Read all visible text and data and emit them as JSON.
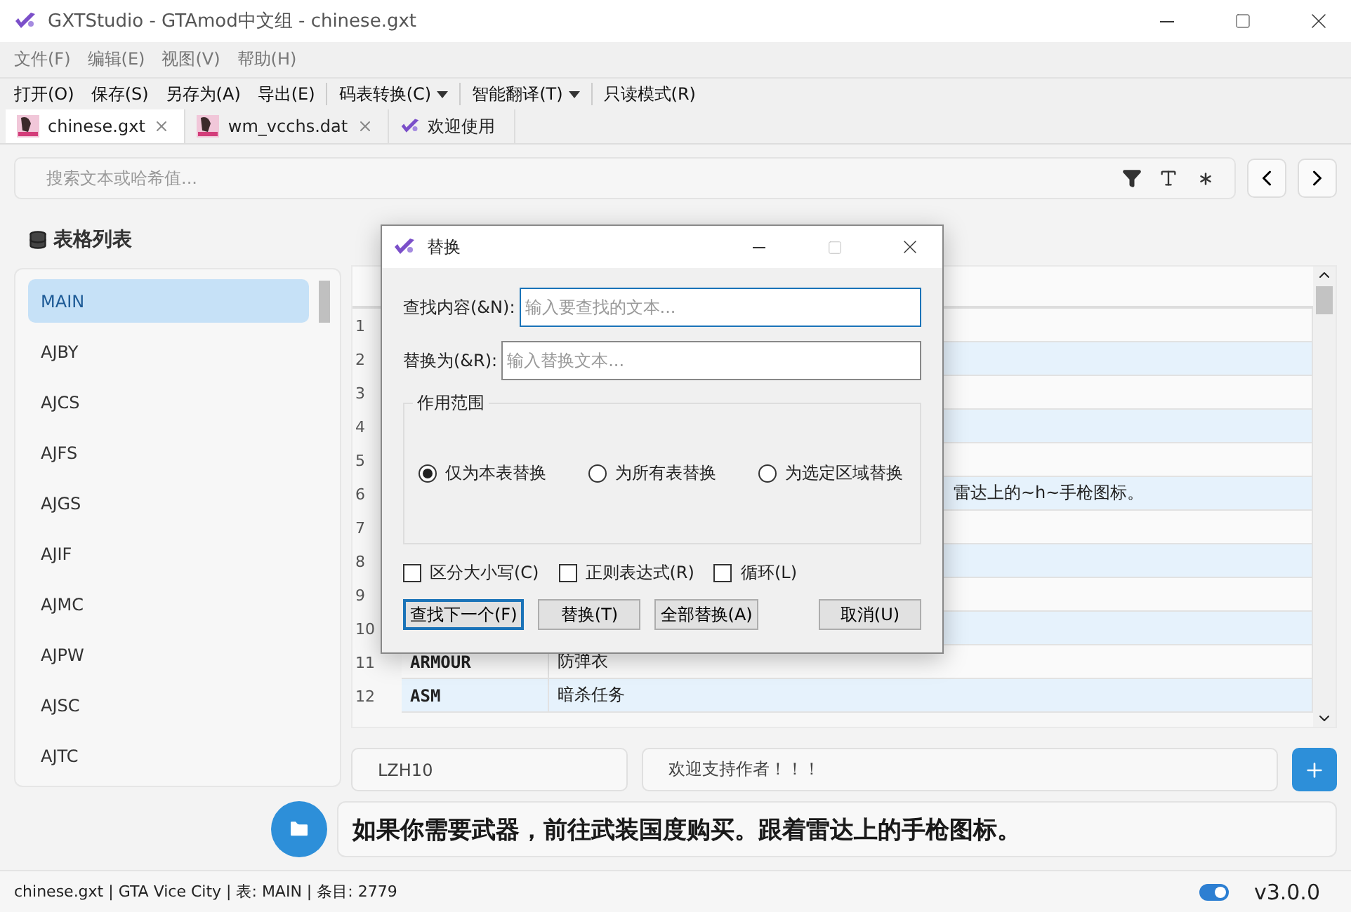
{
  "window": {
    "title": "GXTStudio - GTAmod中文组 - chinese.gxt"
  },
  "menu": [
    "文件(F)",
    "编辑(E)",
    "视图(V)",
    "帮助(H)"
  ],
  "toolbar": [
    {
      "label": "打开(O)",
      "kind": "plain"
    },
    {
      "label": "保存(S)",
      "kind": "plain"
    },
    {
      "label": "另存为(A)",
      "kind": "plain"
    },
    {
      "label": "导出(E)",
      "kind": "plain"
    },
    {
      "label": "码表转换(C)",
      "kind": "dropdown"
    },
    {
      "label": "智能翻译(T)",
      "kind": "dropdown"
    },
    {
      "label": "只读模式(R)",
      "kind": "plain"
    }
  ],
  "tabs": [
    {
      "label": "chinese.gxt",
      "kind": "file",
      "selected": true
    },
    {
      "label": "wm_vcchs.dat",
      "kind": "file",
      "selected": false
    },
    {
      "label": "欢迎使用",
      "kind": "welcome",
      "selected": false
    }
  ],
  "search": {
    "placeholder": "搜索文本或哈希值..."
  },
  "sidebar": {
    "title": "表格列表",
    "items": [
      {
        "label": "MAIN",
        "selected": true
      },
      {
        "label": "AJBY",
        "selected": false
      },
      {
        "label": "AJCS",
        "selected": false
      },
      {
        "label": "AJFS",
        "selected": false
      },
      {
        "label": "AJGS",
        "selected": false
      },
      {
        "label": "AJIF",
        "selected": false
      },
      {
        "label": "AJMC",
        "selected": false
      },
      {
        "label": "AJPW",
        "selected": false
      },
      {
        "label": "AJSC",
        "selected": false
      },
      {
        "label": "AJTC",
        "selected": false
      }
    ]
  },
  "table": {
    "rows": [
      {
        "number": "1"
      },
      {
        "number": "2"
      },
      {
        "number": "3"
      },
      {
        "number": "4"
      },
      {
        "number": "5"
      },
      {
        "number": "6",
        "text": "雷达上的~h~手枪图标。",
        "covered": true
      },
      {
        "number": "7"
      },
      {
        "number": "8"
      },
      {
        "number": "9"
      },
      {
        "number": "10"
      },
      {
        "number": "11",
        "key": "ARMOUR",
        "text": "防弹衣"
      },
      {
        "number": "12",
        "key": "ASM",
        "text": "暗杀任务"
      }
    ]
  },
  "editor": {
    "key_value": "LZH10",
    "text_value": "欢迎支持作者！！！",
    "preview": "如果你需要武器，前往武装国度购买。跟着雷达上的手枪图标。"
  },
  "status_bar": {
    "text": "chinese.gxt | GTA Vice City | 表: MAIN | 条目: 2779",
    "toggle_on": true,
    "version": "v3.0.0"
  },
  "dialog": {
    "title": "替换",
    "find_label": "查找内容(&N):",
    "find_placeholder": "输入要查找的文本...",
    "replace_label": "替换为(&R):",
    "replace_placeholder": "输入替换文本...",
    "scope_title": "作用范围",
    "scope": [
      {
        "label": "仅为本表替换",
        "selected": true
      },
      {
        "label": "为所有表替换",
        "selected": false
      },
      {
        "label": "为选定区域替换",
        "selected": false
      }
    ],
    "options": [
      {
        "label": "区分大小写(C)",
        "checked": false
      },
      {
        "label": "正则表达式(R)",
        "checked": false
      },
      {
        "label": "循环(L)",
        "checked": false
      }
    ],
    "buttons": [
      {
        "label": "查找下一个(F)",
        "kind": "default"
      },
      {
        "label": "替换(T)",
        "kind": "normal"
      },
      {
        "label": "全部替换(A)",
        "kind": "normal"
      },
      {
        "label": "取消(U)",
        "kind": "cancel"
      }
    ]
  }
}
